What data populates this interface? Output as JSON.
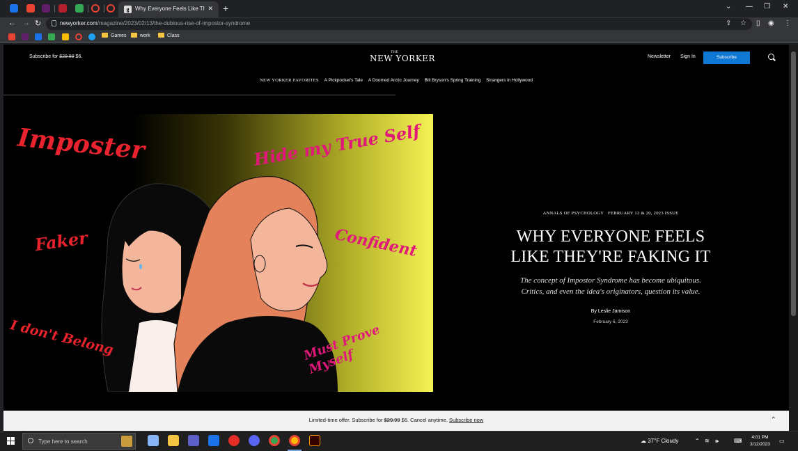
{
  "browser": {
    "active_tab_title": "Why Everyone Feels Like They're",
    "url_prefix": "newyorker.com",
    "url_path": "/magazine/2023/02/13/the-dubious-rise-of-impostor-syndrome",
    "bookmarks": [
      "Games",
      "work",
      "Class"
    ]
  },
  "site_header": {
    "promo_prefix": "Subscribe for ",
    "promo_old_price": "$29.99",
    "promo_new_price": " $6.",
    "logo_small": "THE",
    "logo": "NEW YORKER",
    "newsletter": "Newsletter",
    "sign_in": "Sign In",
    "subscribe": "Subscribe"
  },
  "favorites_bar": {
    "lead": "NEW YORKER FAVORITES",
    "items": [
      "A Pickpocket's Tale",
      "A Doomed Arctic Journey",
      "Bill Bryson's Spring Training",
      "Strangers in Hollywood"
    ]
  },
  "illustration": {
    "words": [
      "Imposter",
      "Hide my True Self",
      "Faker",
      "Confident",
      "I don't Belong",
      "Must Prove Myself"
    ]
  },
  "article": {
    "section": "ANNALS OF PSYCHOLOGY",
    "issue": "FEBRUARY 13 & 20, 2023 ISSUE",
    "headline_line1": "WHY EVERYONE FEELS",
    "headline_line2": "LIKE THEY'RE FAKING IT",
    "dek_line1": "The concept of Impostor Syndrome has become ubiquitous.",
    "dek_line2": "Critics, and even the idea's originators, question its value.",
    "byline": "By Leslie Jamison",
    "date": "February 6, 2023"
  },
  "offer_banner": {
    "prefix": "Limited-time offer. Subscribe for ",
    "old_price": "$29.99",
    "suffix": " $6. Cancel anytime. ",
    "link": "Subscribe now"
  },
  "taskbar": {
    "search_placeholder": "Type here to search",
    "weather": "37°F  Cloudy",
    "time": "4:01 PM",
    "date": "3/12/2023"
  },
  "colors": {
    "subscribe_button": "#0f78d4",
    "illustration_red": "#e8232e",
    "illustration_pink": "#e0187a"
  }
}
